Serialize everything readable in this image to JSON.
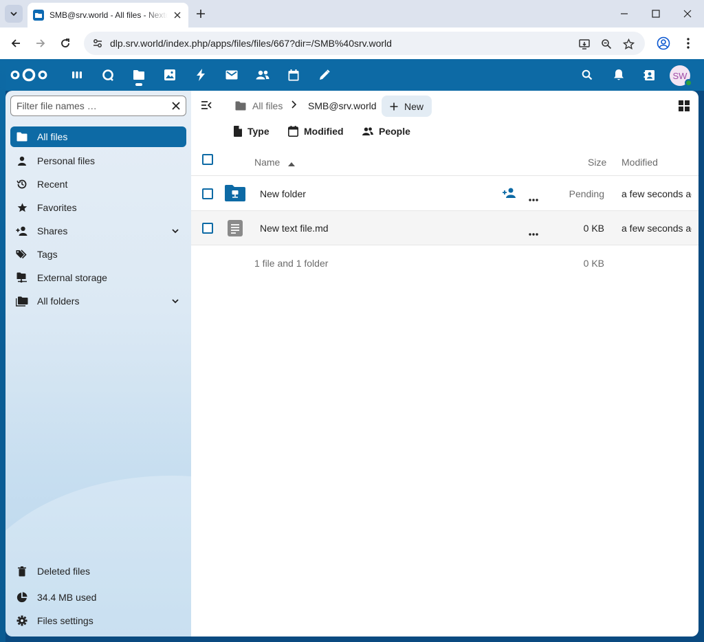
{
  "browser": {
    "tab_title": "SMB@srv.world - All files - Nextcloud",
    "url": "dlp.srv.world/index.php/apps/files/files/667?dir=/SMB%40srv.world"
  },
  "nextcloud": {
    "brand_color": "#0d6aa5",
    "avatar_initials": "SW",
    "apps": [
      "dashboard-icon",
      "talk-icon",
      "files-icon",
      "photos-icon",
      "activity-icon",
      "mail-icon",
      "contacts-icon",
      "calendar-icon",
      "notes-icon"
    ]
  },
  "sidebar": {
    "filter_placeholder": "Filter file names …",
    "items": [
      {
        "label": "All files",
        "icon": "folder-icon"
      },
      {
        "label": "Personal files",
        "icon": "person-icon"
      },
      {
        "label": "Recent",
        "icon": "history-icon"
      },
      {
        "label": "Favorites",
        "icon": "star-icon"
      },
      {
        "label": "Shares",
        "icon": "share-icon"
      },
      {
        "label": "Tags",
        "icon": "tag-icon"
      },
      {
        "label": "External storage",
        "icon": "external-storage-icon"
      },
      {
        "label": "All folders",
        "icon": "folders-icon"
      }
    ],
    "footer": {
      "deleted": "Deleted files",
      "quota": "34.4 MB used",
      "settings": "Files settings"
    }
  },
  "main": {
    "breadcrumb_root": "All files",
    "breadcrumb_current": "SMB@srv.world",
    "new_label": "New",
    "filters": {
      "type": "Type",
      "modified": "Modified",
      "people": "People"
    },
    "columns": {
      "name": "Name",
      "size": "Size",
      "modified": "Modified"
    },
    "rows": [
      {
        "name": "New folder",
        "size": "Pending",
        "modified": "a few seconds ago"
      },
      {
        "name": "New text file.md",
        "size": "0 KB",
        "modified": "a few seconds ago"
      }
    ],
    "summary": {
      "count": "1 file and 1 folder",
      "size": "0 KB"
    }
  }
}
